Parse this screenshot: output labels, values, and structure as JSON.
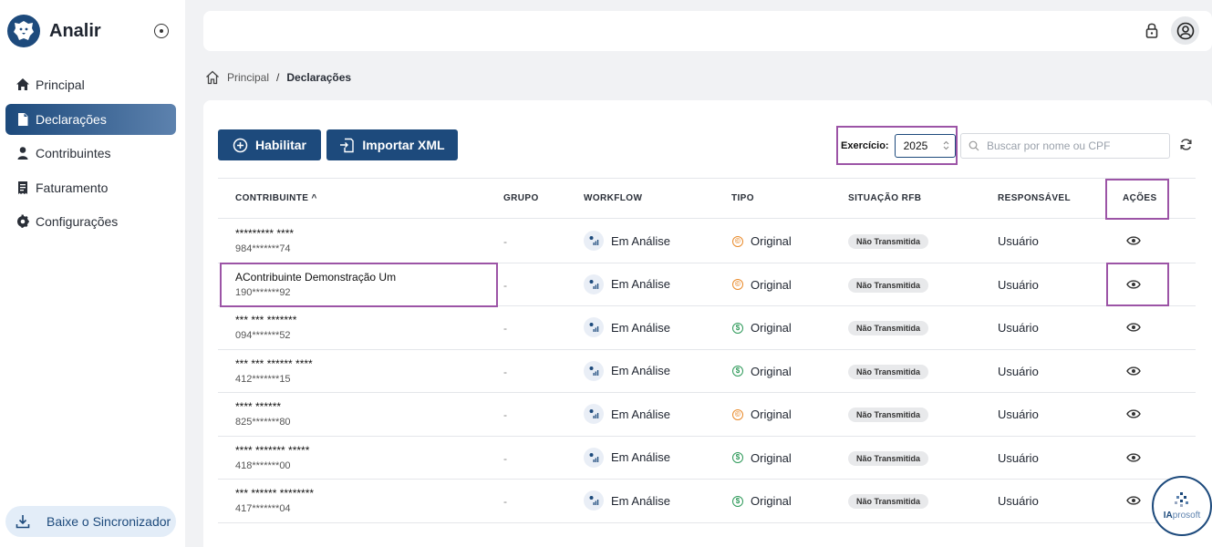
{
  "app": {
    "name": "Analir"
  },
  "sidebar": {
    "items": [
      {
        "label": "Principal",
        "icon": "home-icon"
      },
      {
        "label": "Declarações",
        "icon": "document-icon",
        "active": true
      },
      {
        "label": "Contribuintes",
        "icon": "person-icon"
      },
      {
        "label": "Faturamento",
        "icon": "receipt-icon"
      },
      {
        "label": "Configurações",
        "icon": "gear-icon"
      }
    ],
    "sync_label": "Baixe o Sincronizador"
  },
  "breadcrumb": {
    "home": "Principal",
    "separator": "/",
    "current": "Declarações"
  },
  "toolbar": {
    "habilitar_label": "Habilitar",
    "importar_label": "Importar XML",
    "exercicio_label": "Exercício:",
    "exercicio_value": "2025",
    "search_placeholder": "Buscar por nome ou CPF"
  },
  "table": {
    "headers": {
      "contribuinte": "CONTRIBUINTE",
      "sort_indicator": "^",
      "grupo": "GRUPO",
      "workflow": "WORKFLOW",
      "tipo": "TIPO",
      "situacao": "SITUAÇÃO RFB",
      "responsavel": "RESPONSÁVEL",
      "acoes": "AÇÕES"
    },
    "rows": [
      {
        "name": " ********* ****",
        "cpf": "984*******74",
        "grupo": "-",
        "workflow": "Em Análise",
        "tipo": "Original",
        "tipo_icon": "©",
        "tipo_color": "#e98a2a",
        "situacao": "Não Transmitida",
        "responsavel": "Usuário"
      },
      {
        "name": "AContribuinte Demonstração Um",
        "cpf": "190*******92",
        "grupo": "-",
        "workflow": "Em Análise",
        "tipo": "Original",
        "tipo_icon": "©",
        "tipo_color": "#e98a2a",
        "situacao": "Não Transmitida",
        "responsavel": "Usuário"
      },
      {
        "name": "*** *** *******",
        "cpf": "094*******52",
        "grupo": "-",
        "workflow": "Em Análise",
        "tipo": "Original",
        "tipo_icon": "$",
        "tipo_color": "#2f9a5a",
        "situacao": "Não Transmitida",
        "responsavel": "Usuário"
      },
      {
        "name": "*** *** ****** ****",
        "cpf": "412*******15",
        "grupo": "-",
        "workflow": "Em Análise",
        "tipo": "Original",
        "tipo_icon": "$",
        "tipo_color": "#2f9a5a",
        "situacao": "Não Transmitida",
        "responsavel": "Usuário"
      },
      {
        "name": "**** ******",
        "cpf": "825*******80",
        "grupo": "-",
        "workflow": "Em Análise",
        "tipo": "Original",
        "tipo_icon": "©",
        "tipo_color": "#e98a2a",
        "situacao": "Não Transmitida",
        "responsavel": "Usuário"
      },
      {
        "name": "**** ******* *****",
        "cpf": "418*******00",
        "grupo": "-",
        "workflow": "Em Análise",
        "tipo": "Original",
        "tipo_icon": "$",
        "tipo_color": "#2f9a5a",
        "situacao": "Não Transmitida",
        "responsavel": "Usuário"
      },
      {
        "name": "*** ****** ********",
        "cpf": "417*******04",
        "grupo": "-",
        "workflow": "Em Análise",
        "tipo": "Original",
        "tipo_icon": "$",
        "tipo_color": "#2f9a5a",
        "situacao": "Não Transmitida",
        "responsavel": "Usuário"
      }
    ]
  },
  "widget": {
    "brand_a": "IA",
    "brand_b": "prosoft"
  },
  "colors": {
    "primary": "#1d4a7c",
    "highlight": "#9c54a6"
  }
}
